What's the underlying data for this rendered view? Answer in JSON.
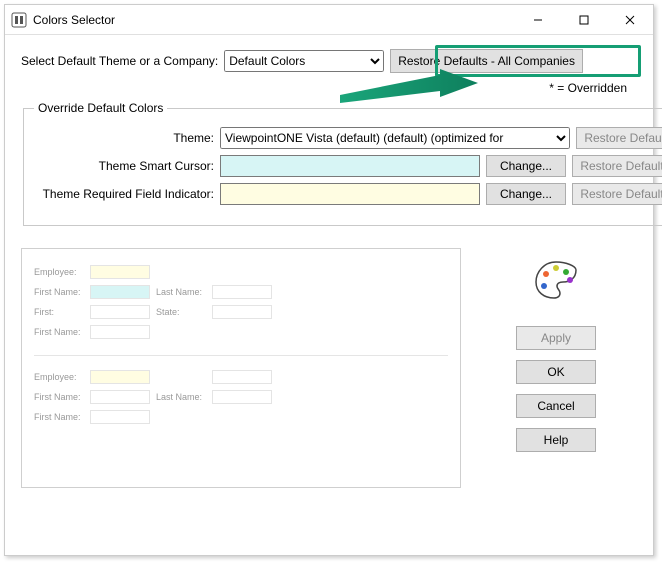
{
  "window": {
    "title": "Colors Selector"
  },
  "top": {
    "label": "Select Default Theme or a Company:",
    "theme_selected": "Default Colors",
    "restore_all_label": "Restore Defaults - All Companies",
    "overridden_note": "* = Overridden"
  },
  "override": {
    "legend": "Override Default Colors",
    "theme_label": "Theme:",
    "theme_value": "ViewpointONE Vista (default) (default) (optimized for",
    "smart_cursor_label": "Theme Smart Cursor:",
    "smart_cursor_color": "#d7f5f5",
    "required_label": "Theme Required Field Indicator:",
    "required_color": "#fffde2",
    "change_label": "Change...",
    "restore_label": "Restore Default"
  },
  "preview": {
    "labels": {
      "employee": "Employee:",
      "first_name": "First Name:",
      "last_name": "Last Name:",
      "first": "First:",
      "state": "State:"
    }
  },
  "buttons": {
    "apply": "Apply",
    "ok": "OK",
    "cancel": "Cancel",
    "help": "Help"
  },
  "colors": {
    "highlight": "#159e74"
  }
}
